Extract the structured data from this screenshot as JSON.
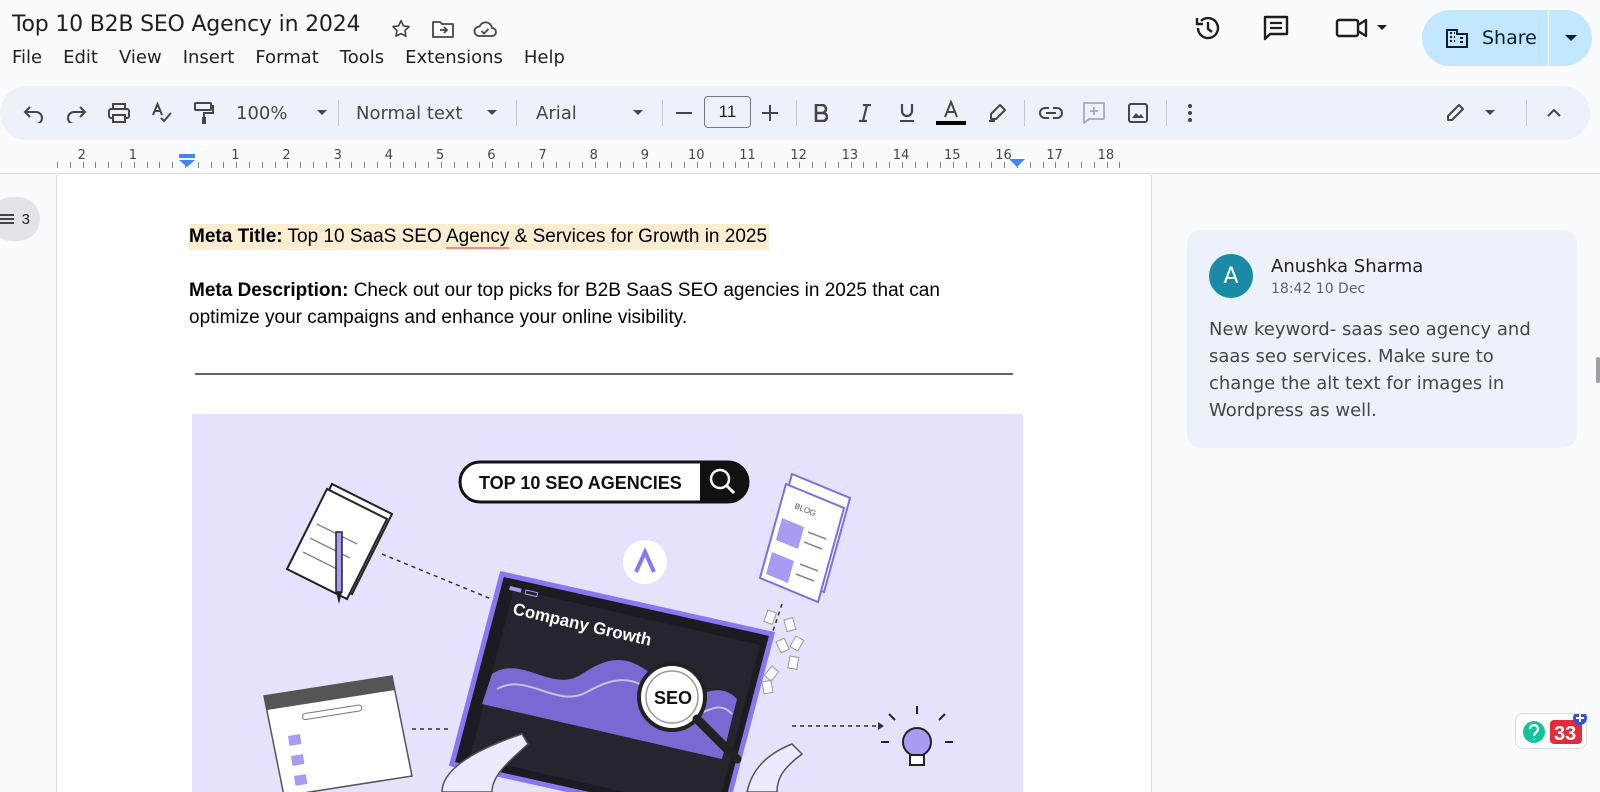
{
  "doc": {
    "title": "Top 10 B2B SEO Agency in 2024"
  },
  "menu": [
    "File",
    "Edit",
    "View",
    "Insert",
    "Format",
    "Tools",
    "Extensions",
    "Help"
  ],
  "share": {
    "label": "Share"
  },
  "toolbar": {
    "zoom": "100%",
    "style": "Normal text",
    "font": "Arial",
    "font_size": "11"
  },
  "ruler": {
    "left_numbers": [
      "2",
      "1"
    ],
    "right_numbers": [
      "1",
      "2",
      "3",
      "4",
      "5",
      "6",
      "7",
      "8",
      "9",
      "10",
      "11",
      "12",
      "13",
      "14",
      "15",
      "16",
      "17",
      "18"
    ]
  },
  "outline": {
    "count": "3"
  },
  "content": {
    "meta_title_label": "Meta Title:",
    "meta_title_pre": " Top 10 SaaS SEO ",
    "meta_title_flagged": "Agency",
    "meta_title_post": " & Services for Growth in 2025",
    "meta_desc_label": "Meta Description:",
    "meta_desc_text": " Check out our top picks for B2B SaaS SEO agencies in 2025 that can optimize your campaigns and enhance your online visibility."
  },
  "illustration": {
    "search_label": "TOP 10 SEO AGENCIES",
    "tablet_title": "Company Growth",
    "seo_label": "SEO",
    "blog_label": "BLOG"
  },
  "comment": {
    "avatar_initial": "A",
    "author": "Anushka Sharma",
    "time": "18:42 10 Dec",
    "body": "New keyword- saas seo agency and saas seo services. Make sure to change the alt text for images in Wordpress as well."
  },
  "extension_badge": {
    "count": "33"
  },
  "colors": {
    "share_bg": "#c2e7ff",
    "highlight": "#fbeed0",
    "avatar": "#1a8ba7",
    "illustration_bg": "#e4e2fc",
    "accent_purple": "#9b8cf0"
  }
}
